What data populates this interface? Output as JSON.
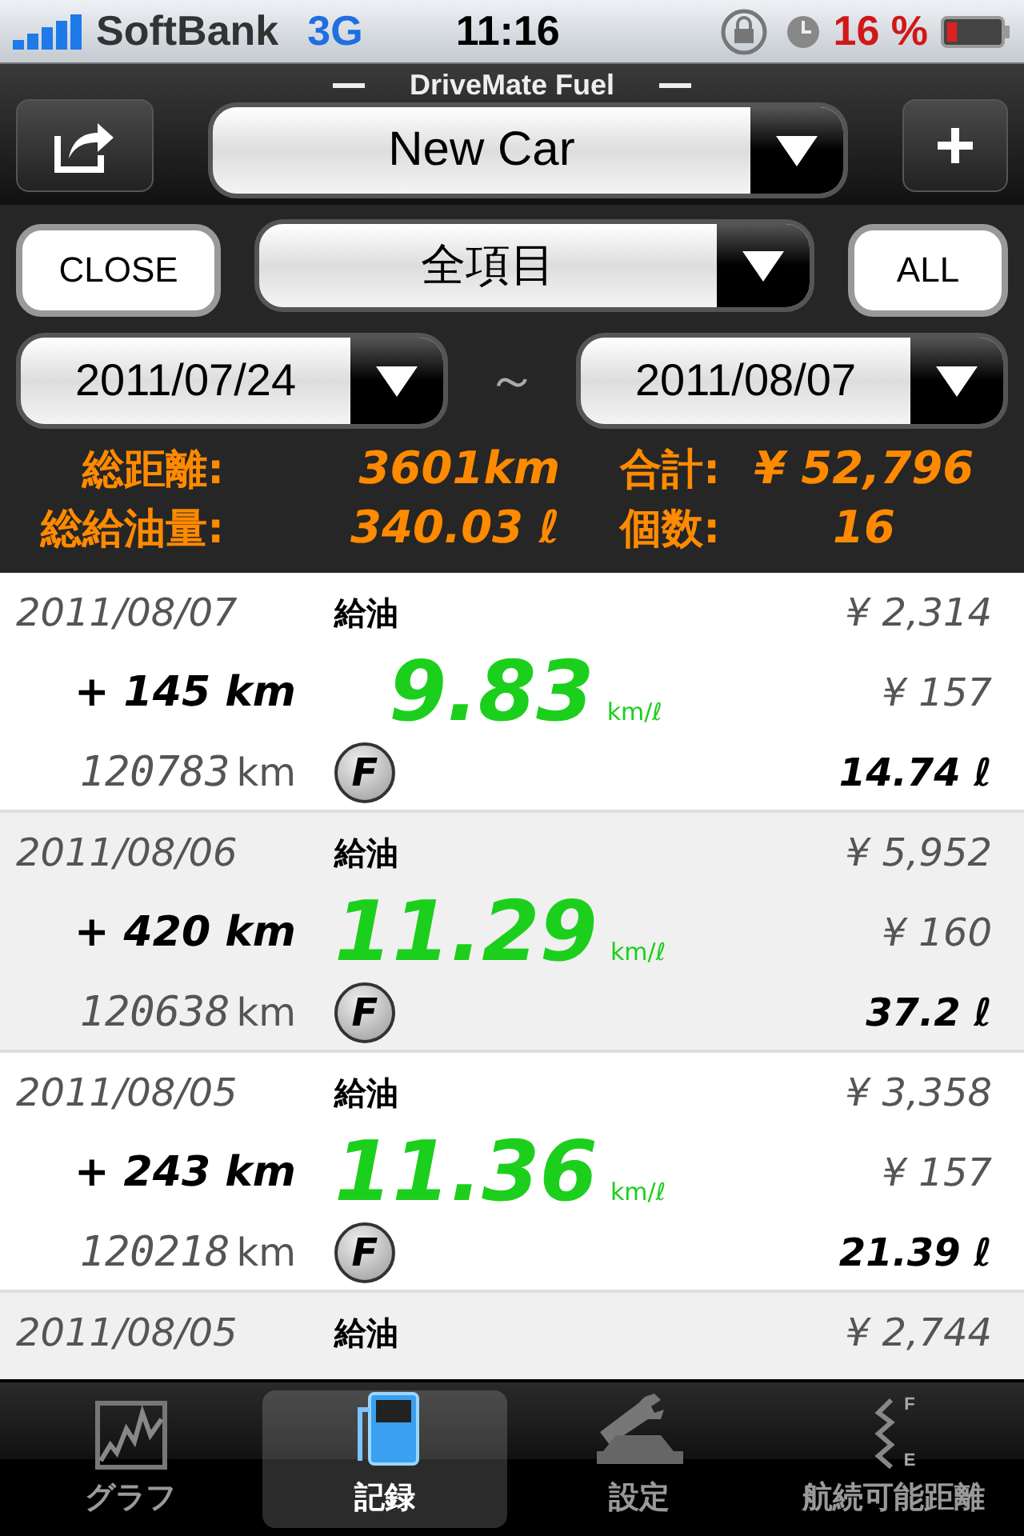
{
  "status_bar": {
    "carrier": "SoftBank",
    "network": "3G",
    "time": "11:16",
    "battery": "16 %"
  },
  "nav": {
    "title": "DriveMate Fuel",
    "car": "New Car"
  },
  "filter": {
    "close": "CLOSE",
    "category": "全項目",
    "all": "ALL",
    "from": "2011/07/24",
    "separator": "～",
    "to": "2011/08/07"
  },
  "summary": [
    {
      "label": "総距離:",
      "value": "3601km",
      "label2": "合計:",
      "value2": "¥ 52,796"
    },
    {
      "label": "総給油量:",
      "value": "340.03 ℓ",
      "label2": "個数:",
      "value2": "16"
    }
  ],
  "records": [
    {
      "date": "2011/08/07",
      "type": "給油",
      "price": "¥ 2,314",
      "distance": "+ 145 km",
      "efficiency": "9.83",
      "efficiency_unit": "km/ℓ",
      "unit_price": "¥ 157",
      "odometer": "120783",
      "odometer_unit": "km",
      "fill_mark": "F",
      "liters": "14.74 ℓ"
    },
    {
      "date": "2011/08/06",
      "type": "給油",
      "price": "¥ 5,952",
      "distance": "+ 420 km",
      "efficiency": "11.29",
      "efficiency_unit": "km/ℓ",
      "unit_price": "¥ 160",
      "odometer": "120638",
      "odometer_unit": "km",
      "fill_mark": "F",
      "liters": "37.2 ℓ"
    },
    {
      "date": "2011/08/05",
      "type": "給油",
      "price": "¥ 3,358",
      "distance": "+ 243 km",
      "efficiency": "11.36",
      "efficiency_unit": "km/ℓ",
      "unit_price": "¥ 157",
      "odometer": "120218",
      "odometer_unit": "km",
      "fill_mark": "F",
      "liters": "21.39 ℓ"
    },
    {
      "date": "2011/08/05",
      "type": "給油",
      "price": "¥ 2,744"
    }
  ],
  "tabs": [
    {
      "kind": "graph",
      "label": "グラフ",
      "selected": false
    },
    {
      "kind": "record",
      "label": "記録",
      "selected": true
    },
    {
      "kind": "settings",
      "label": "設定",
      "selected": false
    },
    {
      "kind": "range",
      "label": "航続可能距離",
      "selected": false,
      "icon_top": "F",
      "icon_bottom": "E"
    }
  ]
}
